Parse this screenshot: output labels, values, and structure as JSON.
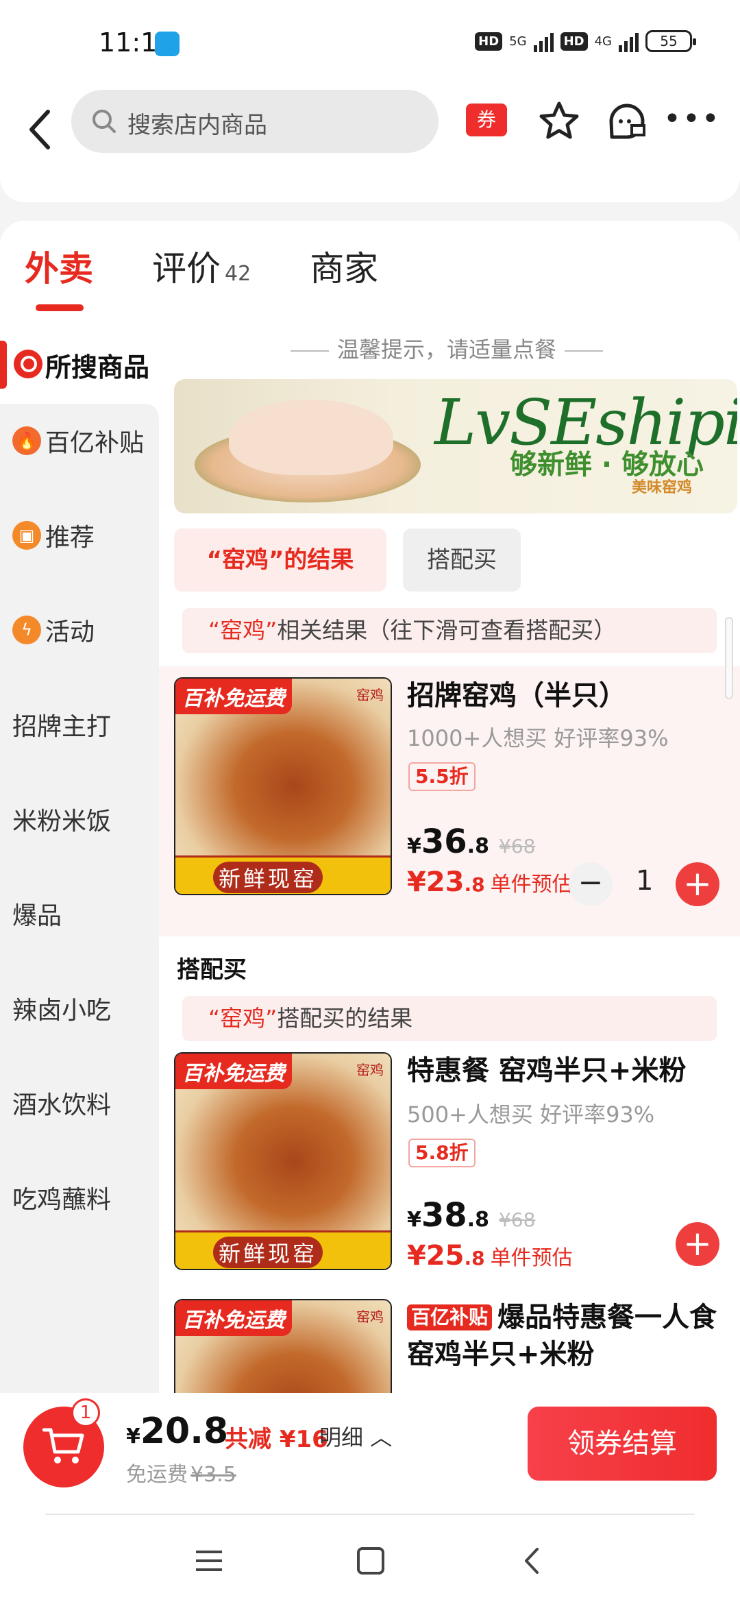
{
  "status_bar": {
    "time": "11:11",
    "hd1": "HD",
    "net1": "5G",
    "hd2": "HD",
    "net2": "4G",
    "battery": "55"
  },
  "header": {
    "search_placeholder": "搜索店内商品",
    "coupon_label": "券",
    "more_label": "•••"
  },
  "tabs": [
    {
      "label": "外卖",
      "active": true
    },
    {
      "label": "评价",
      "count": "42"
    },
    {
      "label": "商家"
    }
  ],
  "sidebar": {
    "active": "所搜商品",
    "items": [
      {
        "label": "百亿补贴",
        "icon": "flame-icon"
      },
      {
        "label": "推荐",
        "icon": "bookmark-icon"
      },
      {
        "label": "活动",
        "icon": "lightning-icon"
      },
      {
        "label": "招牌主打"
      },
      {
        "label": "米粉米饭"
      },
      {
        "label": "爆品"
      },
      {
        "label": "辣卤小吃"
      },
      {
        "label": "酒水饮料"
      },
      {
        "label": "吃鸡蘸料"
      }
    ]
  },
  "main": {
    "tip": "温馨提示，请适量点餐",
    "banner": {
      "brand": "LvSEshipin",
      "slogan": "够新鲜 · 够放心",
      "sub": "美味窑鸡"
    },
    "chips": [
      {
        "label": "“窑鸡”的结果",
        "active": true
      },
      {
        "label": "搭配买"
      }
    ],
    "results_hint": {
      "query": "“窑鸡”",
      "text": "相关结果（往下滑可查看搭配买）"
    },
    "combo_section_title": "搭配买",
    "combo_hint": {
      "query": "“窑鸡”",
      "text": "搭配买的结果"
    },
    "products": [
      {
        "image_tag": "百补免运费",
        "image_stamp": "窑鸡",
        "image_ribbon": "新鲜现窑",
        "title": "招牌窑鸡（半只）",
        "meta": "1000+人想买 好评率93%",
        "discount": "5.5折",
        "price_int": "36",
        "price_dec": ".8",
        "orig_price": "¥68",
        "est_int": "23",
        "est_dec": ".8",
        "est_label": "单件预估",
        "quantity": "1"
      },
      {
        "image_tag": "百补免运费",
        "image_stamp": "窑鸡",
        "image_ribbon": "新鲜现窑",
        "title": "特惠餐 窑鸡半只+米粉",
        "meta": "500+人想买 好评率93%",
        "discount": "5.8折",
        "price_int": "38",
        "price_dec": ".8",
        "orig_price": "¥68",
        "est_int": "25",
        "est_dec": ".8",
        "est_label": "单件预估"
      },
      {
        "image_tag": "百补免运费",
        "image_stamp": "窑鸡",
        "subsidy_badge": "百亿补贴",
        "title": "爆品特惠餐一人食 窑鸡半只+米粉"
      }
    ]
  },
  "cart": {
    "badge": "1",
    "yen": "¥",
    "total": "20.8",
    "saved": "共减 ¥16",
    "detail": "明细",
    "free_shipping": "免运费",
    "shipping_orig": "¥3.5",
    "checkout": "领券结算"
  },
  "colors": {
    "accent": "#e62a1f",
    "checkout": "#ef2d2d"
  }
}
